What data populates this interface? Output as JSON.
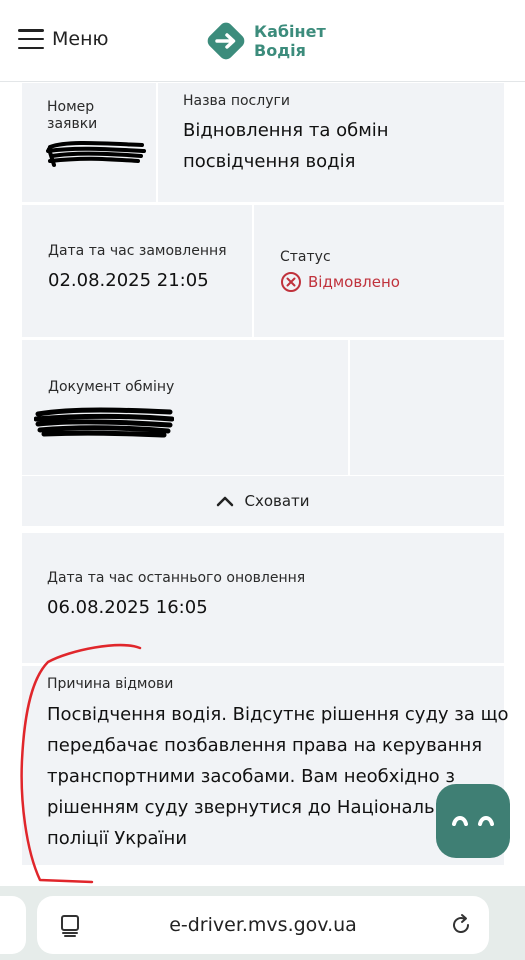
{
  "header": {
    "menu_label": "Меню",
    "logo_line1": "Кабінет",
    "logo_line2": "Водія",
    "brand_color": "#3c8c7c"
  },
  "application": {
    "number_label_line1": "Номер",
    "number_label_line2": "заявки",
    "service_label": "Назва послуги",
    "service_line1": "Відновлення та обмін",
    "service_line2": "посвідчення водія",
    "order_date_label": "Дата та час замовлення",
    "order_date_value": "02.08.2025 21:05",
    "status_label": "Статус",
    "status_value": "Відмовлено",
    "status_color": "#c0323c",
    "document_label": "Документ обміну",
    "hide_label": "Сховати"
  },
  "update": {
    "last_update_label": "Дата та час останнього оновлення",
    "last_update_value": "06.08.2025 16:05",
    "reason_label": "Причина відмови",
    "reason_lines": [
      "Посвідчення водія. Відсутнє рішення суду за що",
      "передбачає позбавлення права на керування",
      "транспортними засобами. Вам необхідно з",
      "рішенням суду звернутися до Національно",
      "поліції України"
    ]
  },
  "browser": {
    "url": "e-driver.mvs.gov.ua"
  },
  "icons": {
    "menu": "hamburger-icon",
    "logo": "arrow-right-diamond-icon",
    "status": "cross-circle-icon",
    "hide": "chevron-up-icon",
    "chat": "chat-bot-icon",
    "tabs": "tabs-icon",
    "reload": "reload-icon"
  }
}
